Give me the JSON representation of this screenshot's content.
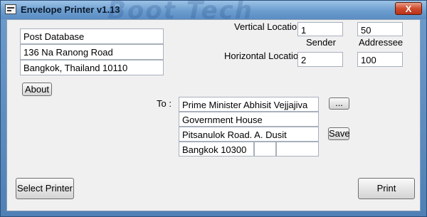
{
  "window": {
    "title": "Envelope Printer v1.13",
    "close_label": "X",
    "watermark": "Boot Tech"
  },
  "sender": {
    "line1": "Post Database",
    "line2": "136 Na Ranong Road",
    "line3": "Bangkok, Thailand 10110"
  },
  "about_label": "About",
  "locations": {
    "vertical_label": "Vertical Locations",
    "horizontal_label": "Horizontal Locations",
    "sender_header": "Sender",
    "addressee_header": "Addressee",
    "vertical_sender": "1",
    "vertical_addressee": "50",
    "horizontal_sender": "2",
    "horizontal_addressee": "100"
  },
  "recipient": {
    "to_label": "To :",
    "line1": "Prime Minister Abhisit Vejjajiva",
    "line2": "Government House",
    "line3": "Pitsanulok Road. A. Dusit",
    "line4a": "Bangkok 10300",
    "line4b": "",
    "line4c": ""
  },
  "browse_label": "...",
  "save_label": "Save",
  "select_printer_label": "Select Printer",
  "print_label": "Print",
  "colors": {
    "title_bar": "#6b9dcf",
    "close_button": "#cf4a2c",
    "client_background": "#f0f0f0"
  },
  "icons": [
    "envelope-app-icon",
    "close-icon"
  ]
}
